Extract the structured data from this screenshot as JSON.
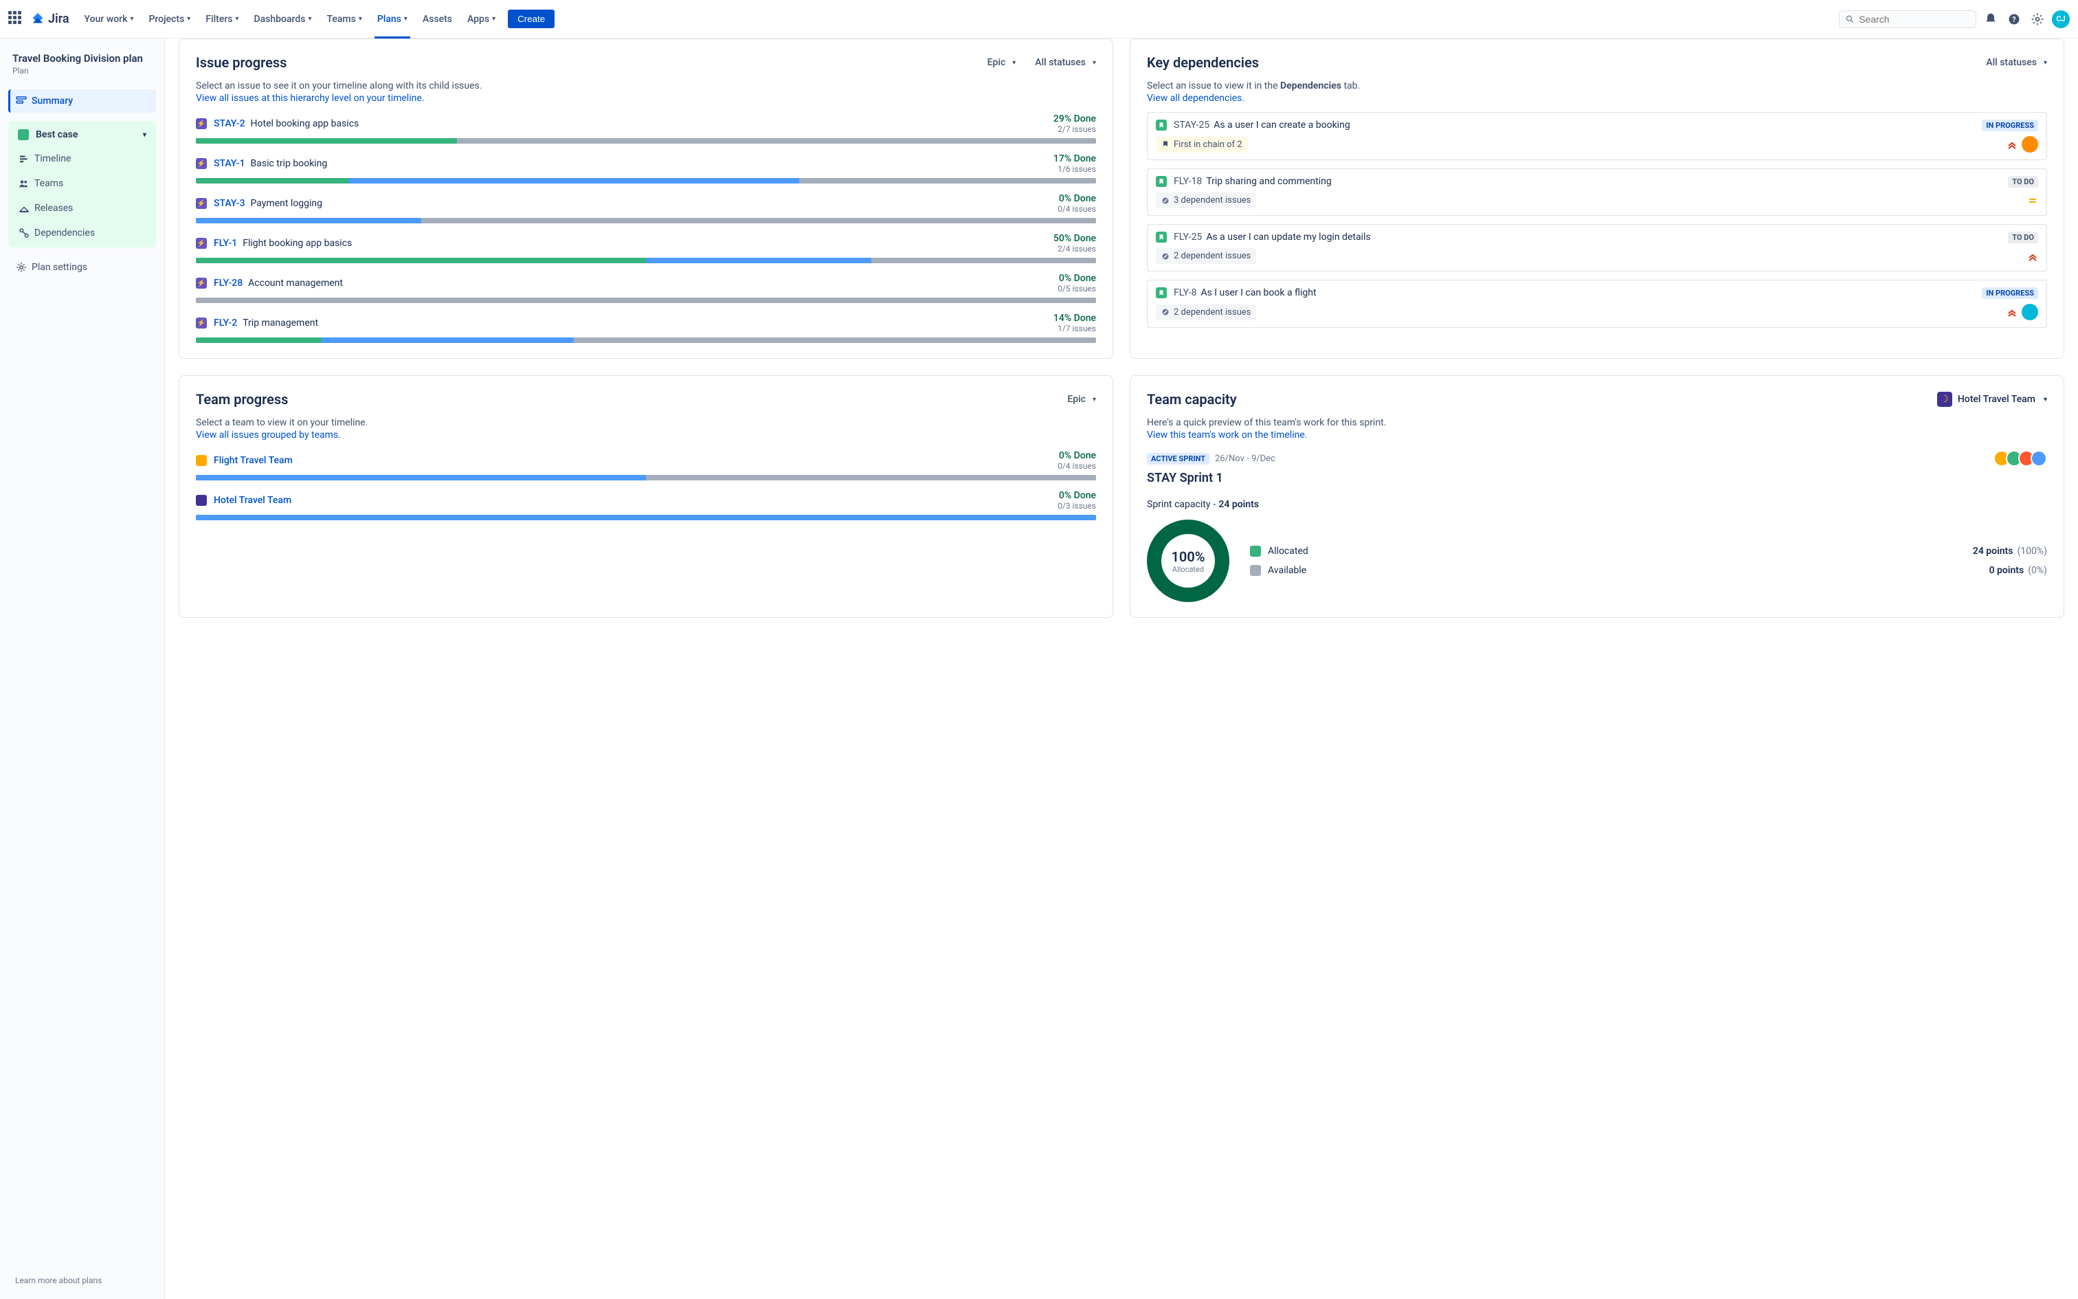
{
  "nav": {
    "logo": "Jira",
    "links": [
      "Your work",
      "Projects",
      "Filters",
      "Dashboards",
      "Teams",
      "Plans",
      "Assets",
      "Apps"
    ],
    "active_index": 5,
    "has_dropdown": [
      true,
      true,
      true,
      true,
      true,
      true,
      false,
      true
    ],
    "create": "Create",
    "search_placeholder": "Search",
    "avatar_initials": "CJ"
  },
  "sidebar": {
    "plan_name": "Travel Booking Division plan",
    "plan_sub": "Plan",
    "summary": "Summary",
    "scenario_name": "Best case",
    "scenario_items": [
      "Timeline",
      "Teams",
      "Releases",
      "Dependencies"
    ],
    "settings": "Plan settings",
    "footer": "Learn more about plans"
  },
  "issue_progress": {
    "title": "Issue progress",
    "level_dropdown": "Epic",
    "status_dropdown": "All statuses",
    "subtitle": "Select an issue to see it on your timeline along with its child issues.",
    "link": "View all issues at this hierarchy level on your timeline.",
    "items": [
      {
        "key": "STAY-2",
        "title": "Hotel booking app basics",
        "pct": "29% Done",
        "count": "2/7 issues",
        "done": 29,
        "inprog": 0
      },
      {
        "key": "STAY-1",
        "title": "Basic trip booking",
        "pct": "17% Done",
        "count": "1/6 issues",
        "done": 17,
        "inprog": 50
      },
      {
        "key": "STAY-3",
        "title": "Payment logging",
        "pct": "0% Done",
        "count": "0/4 issues",
        "done": 0,
        "inprog": 25
      },
      {
        "key": "FLY-1",
        "title": "Flight booking app basics",
        "pct": "50% Done",
        "count": "2/4 issues",
        "done": 50,
        "inprog": 25
      },
      {
        "key": "FLY-28",
        "title": "Account management",
        "pct": "0% Done",
        "count": "0/5 issues",
        "done": 0,
        "inprog": 0
      },
      {
        "key": "FLY-2",
        "title": "Trip management",
        "pct": "14% Done",
        "count": "1/7 issues",
        "done": 14,
        "inprog": 28
      }
    ]
  },
  "dependencies": {
    "title": "Key dependencies",
    "dropdown": "All statuses",
    "subtitle_pre": "Select an issue to view it in the ",
    "subtitle_bold": "Dependencies",
    "subtitle_post": " tab.",
    "link": "View all dependencies.",
    "items": [
      {
        "key": "STAY-25",
        "title": "As a user I can create a booking",
        "status": "IN PROGRESS",
        "status_class": "inprogress",
        "chain": "First in chain of 2",
        "chain_yellow": true,
        "prio": "highest",
        "has_avatar": true,
        "avatar_color": "#FF8B00"
      },
      {
        "key": "FLY-18",
        "title": "Trip sharing and commenting",
        "status": "TO DO",
        "status_class": "todo",
        "chain": "3 dependent issues",
        "chain_yellow": false,
        "prio": "medium",
        "has_avatar": false,
        "avatar_color": ""
      },
      {
        "key": "FLY-25",
        "title": "As a user I can update my login details",
        "status": "TO DO",
        "status_class": "todo",
        "chain": "2 dependent issues",
        "chain_yellow": false,
        "prio": "highest",
        "has_avatar": false,
        "avatar_color": ""
      },
      {
        "key": "FLY-8",
        "title": "As I user I can book a flight",
        "status": "IN PROGRESS",
        "status_class": "inprogress",
        "chain": "2 dependent issues",
        "chain_yellow": false,
        "prio": "highest",
        "has_avatar": true,
        "avatar_color": "#00B8D9"
      }
    ]
  },
  "team_progress": {
    "title": "Team progress",
    "dropdown": "Epic",
    "subtitle": "Select a team to view it on your timeline.",
    "link": "View all issues grouped by teams.",
    "items": [
      {
        "name": "Flight Travel Team",
        "color": "#FFAB00",
        "pct": "0% Done",
        "count": "0/4 issues",
        "inprog": 50
      },
      {
        "name": "Hotel Travel Team",
        "color": "#403294",
        "pct": "0% Done",
        "count": "0/3 issues",
        "inprog": 100
      }
    ]
  },
  "team_capacity": {
    "title": "Team capacity",
    "team_name": "Hotel Travel Team",
    "subtitle": "Here's a quick preview of this team's work for this sprint.",
    "link": "View this team's work on the timeline.",
    "active_label": "ACTIVE SPRINT",
    "date_range": "26/Nov - 9/Dec",
    "sprint_name": "STAY Sprint 1",
    "capacity_label": "Sprint capacity",
    "capacity_sep": "-",
    "capacity_value": "24 points",
    "donut_pct": "100%",
    "donut_label": "Allocated",
    "avatar_colors": [
      "#FFAB00",
      "#36B37E",
      "#FF5630",
      "#4C9AFF"
    ],
    "legend": [
      {
        "label": "Allocated",
        "color": "#36B37E",
        "value": "24 points",
        "pct": "(100%)"
      },
      {
        "label": "Available",
        "color": "#A5ADBA",
        "value": "0 points",
        "pct": "(0%)"
      }
    ]
  }
}
